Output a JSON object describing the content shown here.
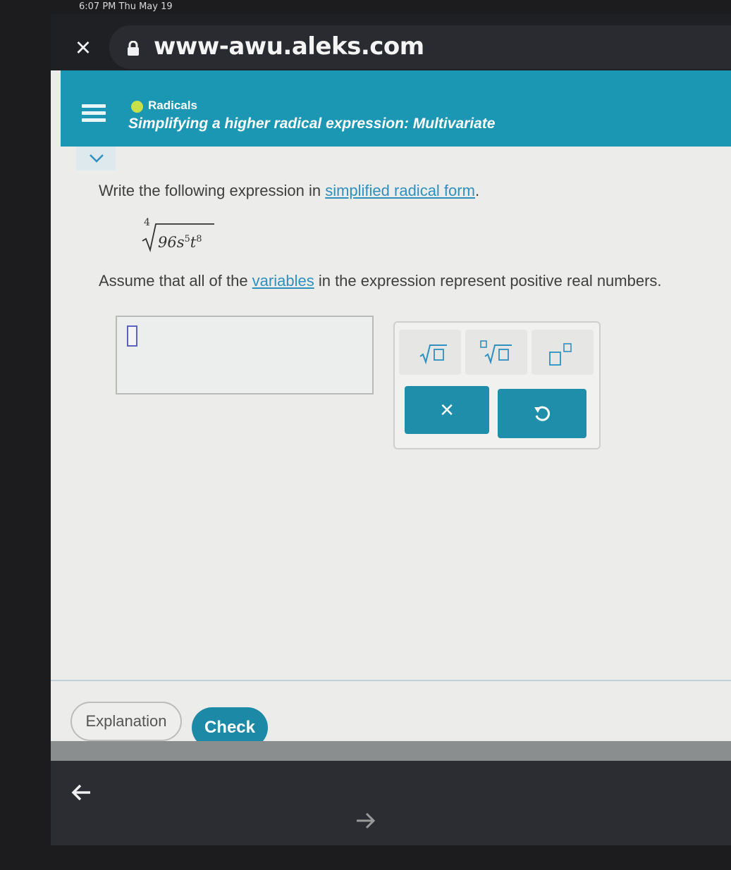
{
  "status": {
    "time_text": "6:07 PM  Thu May 19"
  },
  "browser": {
    "url": "www-awu.aleks.com"
  },
  "topic": {
    "category": "Radicals",
    "title": "Simplifying a higher radical expression: Multivariate"
  },
  "question": {
    "prompt_before": "Write the following expression in ",
    "prompt_link": "simplified radical form",
    "prompt_after": ".",
    "radical_index": "4",
    "radicand_coeff": "96",
    "radicand_var1": "s",
    "radicand_exp1": "5",
    "radicand_var2": "t",
    "radicand_exp2": "8",
    "assume_before": "Assume that all of the ",
    "assume_link": "variables",
    "assume_after": " in the expression represent positive real numbers."
  },
  "keypad": {
    "keys": [
      "sqrt",
      "nth-root",
      "superscript"
    ],
    "clear_label": "×"
  },
  "footer": {
    "explanation_label": "Explanation",
    "check_label": "Check"
  },
  "colors": {
    "header": "#1b97b3",
    "button": "#1e8eaa",
    "link": "#2f8fbf"
  }
}
